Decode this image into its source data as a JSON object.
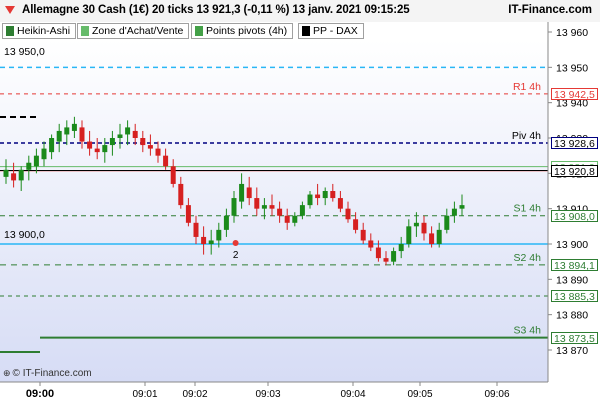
{
  "header": {
    "title": "Allemagne 30 Cash (1€) 20 ticks 13 921,3 (-0,11 %) 13 janv. 2021 09:15:25",
    "brand": "IT-Finance.com",
    "arrow_color": "#e53935"
  },
  "toolbar": {
    "buttons": [
      {
        "label": "Heikin-Ashi",
        "swatch": "#2e7d32"
      },
      {
        "label": "Zone d'Achat/Vente",
        "swatch": "#66bb6a"
      },
      {
        "label": "Points pivots (4h)",
        "swatch": "#43a047"
      },
      {
        "label": "PP - DAX",
        "swatch": "#000000"
      }
    ]
  },
  "left_labels": {
    "top": "13 950,0",
    "mid": "13 900,0"
  },
  "footer": "© IT-Finance.com",
  "chart_data": {
    "type": "candlestick",
    "style": "heikin-ashi",
    "ylim": [
      13868,
      13967
    ],
    "x_ticks": [
      "09:00",
      "09:01",
      "09:02",
      "09:03",
      "09:04",
      "09:05",
      "09:06"
    ],
    "y_ticks": [
      "13 960",
      "13 950",
      "13 940",
      "13 930",
      "13 920",
      "13 910",
      "13 900",
      "13 890",
      "13 880",
      "13 870"
    ],
    "pivot_levels": [
      {
        "name": "R1 4h",
        "value": 13942.5,
        "label": "13 942,5",
        "color": "#e53935"
      },
      {
        "name": "Piv 4h",
        "value": 13928.6,
        "label": "13 928,6",
        "color": "#000080"
      },
      {
        "name": "",
        "value": 13921.9,
        "label": "13 921,9",
        "color": "#66bb6a"
      },
      {
        "name": "",
        "value": 13920.7,
        "label": "13 920,7",
        "color": "#e57373"
      },
      {
        "name": "",
        "value": 13920.8,
        "label": "13 920,8",
        "color": "#000000"
      },
      {
        "name": "S1 4h",
        "value": 13908.0,
        "label": "13 908,0",
        "color": "#2e7d32"
      },
      {
        "name": "S2 4h",
        "value": 13894.1,
        "label": "13 894,1",
        "color": "#2e7d32"
      },
      {
        "name": "",
        "value": 13885.3,
        "label": "13 885,3",
        "color": "#2e7d32"
      },
      {
        "name": "S3 4h",
        "value": 13873.5,
        "label": "13 873,5",
        "color": "#2e7d32"
      }
    ],
    "reference_lines": [
      {
        "value": 13950.0,
        "color": "#29b6f6"
      },
      {
        "value": 13900.0,
        "color": "#29b6f6"
      }
    ],
    "marker": {
      "label": "2",
      "x_index": 31
    },
    "candles": [
      {
        "o": 13919,
        "h": 13924,
        "l": 13917,
        "c": 13921
      },
      {
        "o": 13920,
        "h": 13923,
        "l": 13916,
        "c": 13918
      },
      {
        "o": 13918,
        "h": 13922,
        "l": 13915,
        "c": 13921
      },
      {
        "o": 13921,
        "h": 13925,
        "l": 13918,
        "c": 13923
      },
      {
        "o": 13922,
        "h": 13927,
        "l": 13920,
        "c": 13925
      },
      {
        "o": 13924,
        "h": 13929,
        "l": 13922,
        "c": 13927
      },
      {
        "o": 13926,
        "h": 13931,
        "l": 13924,
        "c": 13930
      },
      {
        "o": 13929,
        "h": 13934,
        "l": 13926,
        "c": 13932
      },
      {
        "o": 13931,
        "h": 13935,
        "l": 13928,
        "c": 13933
      },
      {
        "o": 13932,
        "h": 13936,
        "l": 13930,
        "c": 13934
      },
      {
        "o": 13933,
        "h": 13935,
        "l": 13927,
        "c": 13929
      },
      {
        "o": 13929,
        "h": 13932,
        "l": 13925,
        "c": 13927
      },
      {
        "o": 13927,
        "h": 13930,
        "l": 13924,
        "c": 13926
      },
      {
        "o": 13926,
        "h": 13930,
        "l": 13923,
        "c": 13928
      },
      {
        "o": 13928,
        "h": 13932,
        "l": 13925,
        "c": 13930
      },
      {
        "o": 13930,
        "h": 13934,
        "l": 13927,
        "c": 13931
      },
      {
        "o": 13931,
        "h": 13935,
        "l": 13928,
        "c": 13933
      },
      {
        "o": 13932,
        "h": 13934,
        "l": 13928,
        "c": 13930
      },
      {
        "o": 13930,
        "h": 13932,
        "l": 13926,
        "c": 13928
      },
      {
        "o": 13928,
        "h": 13931,
        "l": 13925,
        "c": 13927
      },
      {
        "o": 13927,
        "h": 13929,
        "l": 13923,
        "c": 13925
      },
      {
        "o": 13925,
        "h": 13927,
        "l": 13921,
        "c": 13922
      },
      {
        "o": 13922,
        "h": 13924,
        "l": 13916,
        "c": 13917
      },
      {
        "o": 13917,
        "h": 13919,
        "l": 13910,
        "c": 13911
      },
      {
        "o": 13911,
        "h": 13913,
        "l": 13905,
        "c": 13906
      },
      {
        "o": 13906,
        "h": 13908,
        "l": 13900,
        "c": 13902
      },
      {
        "o": 13902,
        "h": 13905,
        "l": 13897,
        "c": 13900
      },
      {
        "o": 13900,
        "h": 13904,
        "l": 13897,
        "c": 13901
      },
      {
        "o": 13901,
        "h": 13906,
        "l": 13899,
        "c": 13904
      },
      {
        "o": 13904,
        "h": 13910,
        "l": 13902,
        "c": 13908
      },
      {
        "o": 13908,
        "h": 13915,
        "l": 13906,
        "c": 13913
      },
      {
        "o": 13912,
        "h": 13920,
        "l": 13910,
        "c": 13917
      },
      {
        "o": 13916,
        "h": 13919,
        "l": 13911,
        "c": 13913
      },
      {
        "o": 13913,
        "h": 13916,
        "l": 13908,
        "c": 13910
      },
      {
        "o": 13910,
        "h": 13913,
        "l": 13907,
        "c": 13911
      },
      {
        "o": 13911,
        "h": 13914,
        "l": 13908,
        "c": 13910
      },
      {
        "o": 13910,
        "h": 13912,
        "l": 13906,
        "c": 13908
      },
      {
        "o": 13908,
        "h": 13910,
        "l": 13904,
        "c": 13906
      },
      {
        "o": 13906,
        "h": 13909,
        "l": 13905,
        "c": 13908
      },
      {
        "o": 13908,
        "h": 13912,
        "l": 13907,
        "c": 13911
      },
      {
        "o": 13911,
        "h": 13915,
        "l": 13910,
        "c": 13914
      },
      {
        "o": 13914,
        "h": 13917,
        "l": 13911,
        "c": 13913
      },
      {
        "o": 13913,
        "h": 13916,
        "l": 13911,
        "c": 13915
      },
      {
        "o": 13915,
        "h": 13917,
        "l": 13912,
        "c": 13913
      },
      {
        "o": 13913,
        "h": 13915,
        "l": 13909,
        "c": 13910
      },
      {
        "o": 13910,
        "h": 13912,
        "l": 13906,
        "c": 13907
      },
      {
        "o": 13907,
        "h": 13909,
        "l": 13903,
        "c": 13904
      },
      {
        "o": 13904,
        "h": 13906,
        "l": 13900,
        "c": 13901
      },
      {
        "o": 13901,
        "h": 13903,
        "l": 13898,
        "c": 13899
      },
      {
        "o": 13899,
        "h": 13901,
        "l": 13895,
        "c": 13896
      },
      {
        "o": 13896,
        "h": 13898,
        "l": 13894,
        "c": 13895
      },
      {
        "o": 13895,
        "h": 13899,
        "l": 13894,
        "c": 13898
      },
      {
        "o": 13898,
        "h": 13902,
        "l": 13896,
        "c": 13900
      },
      {
        "o": 13900,
        "h": 13907,
        "l": 13899,
        "c": 13905
      },
      {
        "o": 13905,
        "h": 13909,
        "l": 13902,
        "c": 13906
      },
      {
        "o": 13906,
        "h": 13908,
        "l": 13901,
        "c": 13903
      },
      {
        "o": 13903,
        "h": 13905,
        "l": 13899,
        "c": 13900
      },
      {
        "o": 13900,
        "h": 13906,
        "l": 13899,
        "c": 13904
      },
      {
        "o": 13904,
        "h": 13910,
        "l": 13903,
        "c": 13908
      },
      {
        "o": 13908,
        "h": 13912,
        "l": 13906,
        "c": 13910
      },
      {
        "o": 13910,
        "h": 13914,
        "l": 13908,
        "c": 13911
      }
    ]
  }
}
